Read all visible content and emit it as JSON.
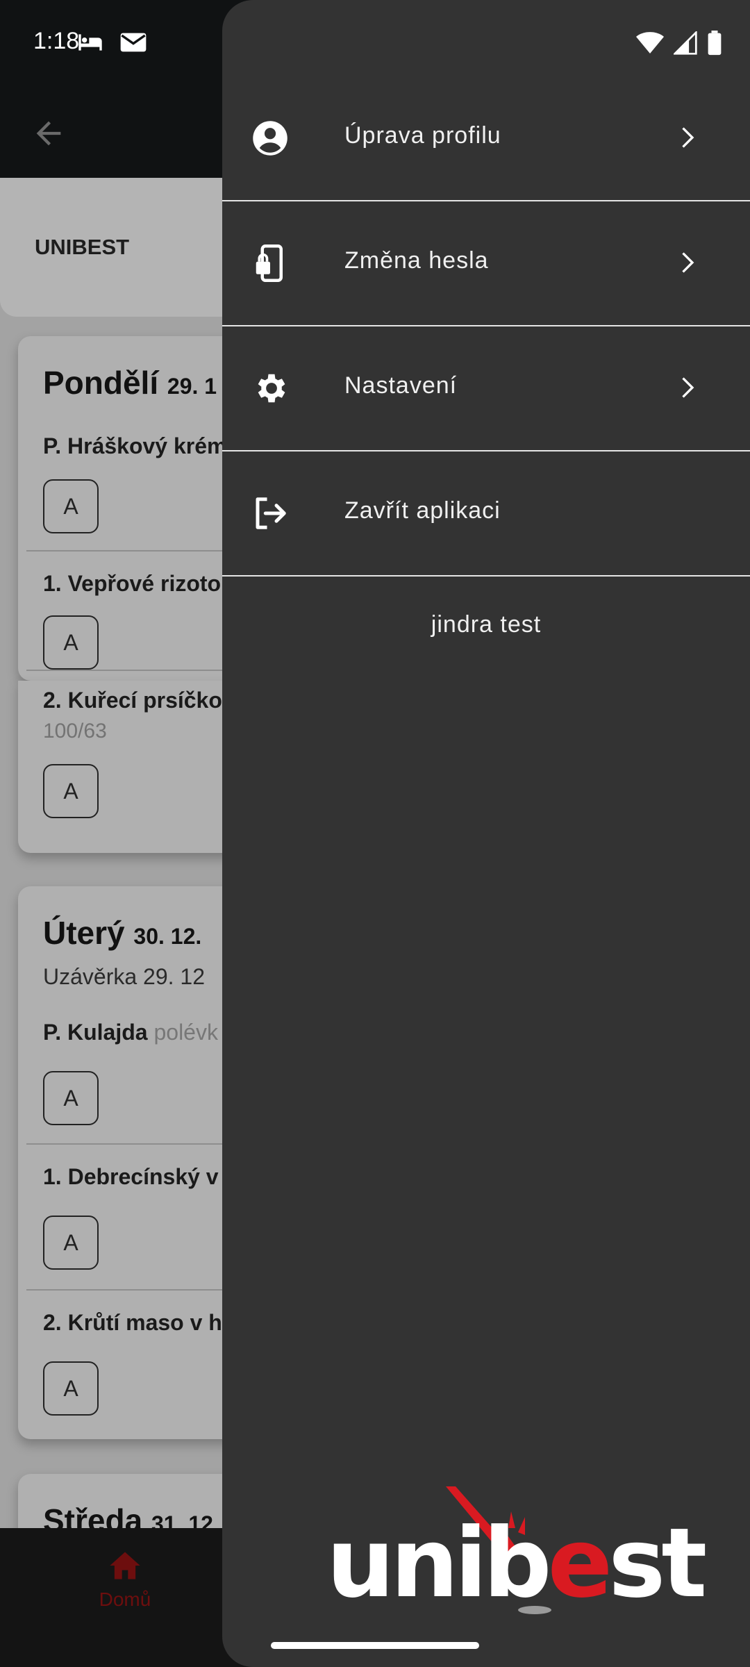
{
  "status_bar": {
    "time": "1:18"
  },
  "app_bar": {
    "canteen": "UNIBEST"
  },
  "days": [
    {
      "day": "Pondělí",
      "date": "29. 1",
      "meals": [
        {
          "name": "P. Hráškový krém",
          "extra": "",
          "weight": "",
          "option": "A"
        },
        {
          "name": "1. Vepřové rizoto",
          "extra": "",
          "weight": "",
          "option": "A"
        },
        {
          "name": "2. Kuřecí prsíčko",
          "extra": "",
          "weight": "100/63",
          "option": "A"
        }
      ]
    },
    {
      "day": "Úterý",
      "date": "30. 12.",
      "deadline": "Uzávěrka 29. 12",
      "meals": [
        {
          "name": "P. Kulajda",
          "extra": "polévk",
          "weight": "",
          "option": "A"
        },
        {
          "name": "1. Debrecínský v",
          "extra": "",
          "weight": "",
          "option": "A"
        },
        {
          "name": "2. Krůtí maso v h",
          "extra": "",
          "weight": "",
          "option": "A"
        }
      ]
    },
    {
      "day": "Středa",
      "date": "31. 12"
    }
  ],
  "bottom_nav": {
    "home_label": "Domů"
  },
  "drawer": {
    "items": [
      {
        "label": "Úprava profilu",
        "icon": "account-circle-icon"
      },
      {
        "label": "Změna hesla",
        "icon": "phone-lock-icon"
      },
      {
        "label": "Nastavení",
        "icon": "gear-icon"
      },
      {
        "label": "Zavřít aplikaci",
        "icon": "logout-icon"
      }
    ],
    "user_name": "jindra test",
    "logo": {
      "part1": "unib",
      "part2": "e",
      "part3": "st"
    }
  },
  "colors": {
    "drawer_bg": "#333333",
    "brand_red": "#d91a21",
    "scrim": "#a3a3a3"
  }
}
